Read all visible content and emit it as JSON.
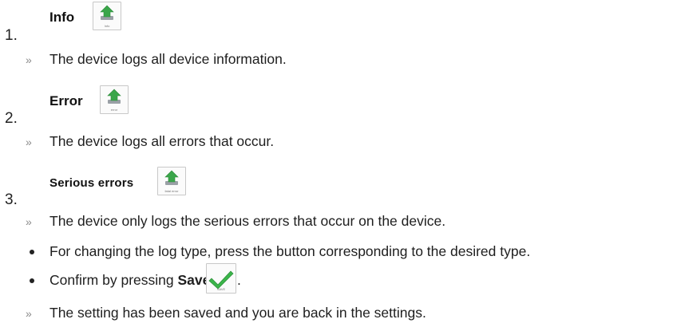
{
  "items": [
    {
      "number": "1.",
      "title": "Info",
      "icon_caption": "Info",
      "icon": "upload-arrow-icon",
      "desc": "The device logs all device information."
    },
    {
      "number": "2.",
      "title": "Error",
      "icon_caption": "error",
      "icon": "upload-arrow-icon",
      "desc": "The device logs all errors that occur."
    },
    {
      "number": "3.",
      "title": "Serious errors",
      "icon_caption": "fatal error",
      "icon": "upload-arrow-icon",
      "desc": "The device only logs the serious errors that occur on the device."
    }
  ],
  "bullets": {
    "change": "For changing the log type, press the button corresponding to the desired type.",
    "confirm_prefix": "Confirm by pressing ",
    "confirm_bold": "Save",
    "confirm_suffix": ".",
    "save_icon": "checkmark-icon",
    "save_caption": "SAVE"
  },
  "result": "The setting has been saved and you are back in the settings.",
  "colors": {
    "arrow_green": "#3aa64a",
    "check_green": "#3bb54a",
    "tray_gray": "#9aa0a6"
  }
}
